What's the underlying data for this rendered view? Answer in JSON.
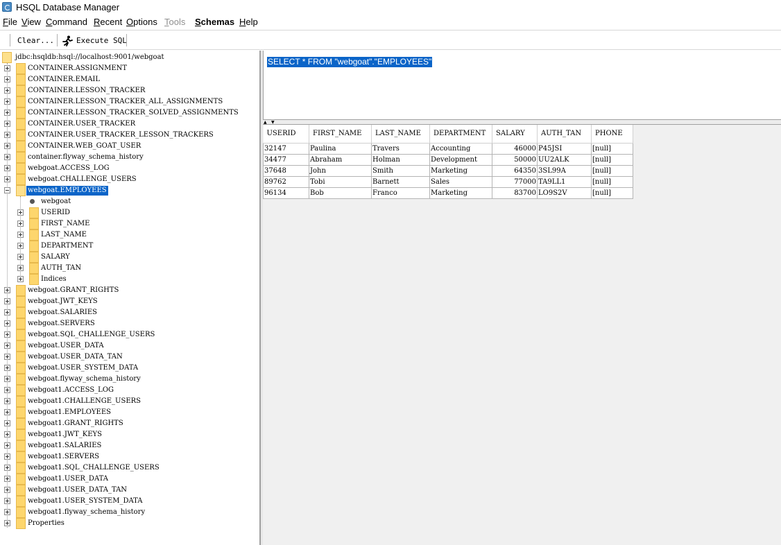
{
  "window": {
    "title": "HSQL Database Manager"
  },
  "menu": {
    "items": [
      {
        "label": "File",
        "underline": "F",
        "rest": "ile"
      },
      {
        "label": "View",
        "underline": "V",
        "rest": "iew"
      },
      {
        "label": "Command",
        "underline": "C",
        "rest": "ommand"
      },
      {
        "label": "Recent",
        "underline": "R",
        "rest": "ecent"
      },
      {
        "label": "Options",
        "underline": "O",
        "rest": "ptions"
      },
      {
        "label": "Tools",
        "underline": "T",
        "rest": "ools"
      },
      {
        "label": "Schemas",
        "underline": "S",
        "rest": "chemas"
      },
      {
        "label": "Help",
        "underline": "H",
        "rest": "elp"
      }
    ]
  },
  "toolbar": {
    "clear_label": "Clear...",
    "execute_label": "Execute SQL"
  },
  "tree": {
    "root": "jdbc:hsqldb:hsql://localhost:9001/webgoat",
    "nodes_before": [
      "CONTAINER.ASSIGNMENT",
      "CONTAINER.EMAIL",
      "CONTAINER.LESSON_TRACKER",
      "CONTAINER.LESSON_TRACKER_ALL_ASSIGNMENTS",
      "CONTAINER.LESSON_TRACKER_SOLVED_ASSIGNMENTS",
      "CONTAINER.USER_TRACKER",
      "CONTAINER.USER_TRACKER_LESSON_TRACKERS",
      "CONTAINER.WEB_GOAT_USER",
      "container.flyway_schema_history",
      "webgoat.ACCESS_LOG",
      "webgoat.CHALLENGE_USERS"
    ],
    "selected": "webgoat.EMPLOYEES",
    "selected_children": {
      "schema": "webgoat",
      "columns": [
        "USERID",
        "FIRST_NAME",
        "LAST_NAME",
        "DEPARTMENT",
        "SALARY",
        "AUTH_TAN",
        "Indices"
      ]
    },
    "nodes_after": [
      "webgoat.GRANT_RIGHTS",
      "webgoat.JWT_KEYS",
      "webgoat.SALARIES",
      "webgoat.SERVERS",
      "webgoat.SQL_CHALLENGE_USERS",
      "webgoat.USER_DATA",
      "webgoat.USER_DATA_TAN",
      "webgoat.USER_SYSTEM_DATA",
      "webgoat.flyway_schema_history",
      "webgoat1.ACCESS_LOG",
      "webgoat1.CHALLENGE_USERS",
      "webgoat1.EMPLOYEES",
      "webgoat1.GRANT_RIGHTS",
      "webgoat1.JWT_KEYS",
      "webgoat1.SALARIES",
      "webgoat1.SERVERS",
      "webgoat1.SQL_CHALLENGE_USERS",
      "webgoat1.USER_DATA",
      "webgoat1.USER_DATA_TAN",
      "webgoat1.USER_SYSTEM_DATA",
      "webgoat1.flyway_schema_history",
      "Properties"
    ]
  },
  "editor": {
    "sql": "SELECT * FROM \"webgoat\".\"EMPLOYEES\""
  },
  "results": {
    "columns": [
      "USERID",
      "FIRST_NAME",
      "LAST_NAME",
      "DEPARTMENT",
      "SALARY",
      "AUTH_TAN",
      "PHONE"
    ],
    "rows": [
      [
        "32147",
        "Paulina",
        "Travers",
        "Accounting",
        "46000",
        "P45JSI",
        "[null]"
      ],
      [
        "34477",
        "Abraham",
        "Holman",
        "Development",
        "50000",
        "UU2ALK",
        "[null]"
      ],
      [
        "37648",
        "John",
        "Smith",
        "Marketing",
        "64350",
        "3SL99A",
        "[null]"
      ],
      [
        "89762",
        "Tobi",
        "Barnett",
        "Sales",
        "77000",
        "TA9LL1",
        "[null]"
      ],
      [
        "96134",
        "Bob",
        "Franco",
        "Marketing",
        "83700",
        "LO9S2V",
        "[null]"
      ]
    ]
  },
  "colors": {
    "selection": "#0a64c8",
    "folder": "#fdd66d"
  }
}
